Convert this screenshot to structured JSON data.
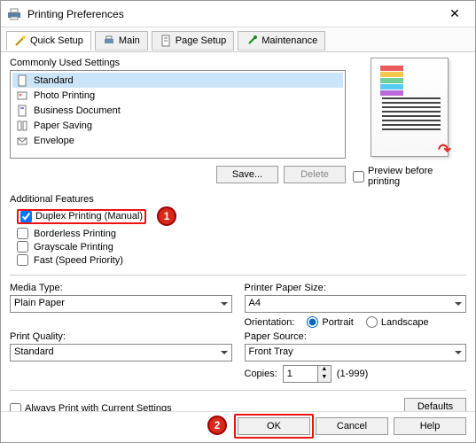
{
  "title": "Printing Preferences",
  "tabs": {
    "quick": "Quick Setup",
    "main": "Main",
    "page": "Page Setup",
    "maint": "Maintenance"
  },
  "commonly_used_label": "Commonly Used Settings",
  "settings_list": {
    "0": "Standard",
    "1": "Photo Printing",
    "2": "Business Document",
    "3": "Paper Saving",
    "4": "Envelope"
  },
  "save_btn": "Save...",
  "delete_btn": "Delete",
  "preview_checkbox": "Preview before printing",
  "additional_features_label": "Additional Features",
  "features": {
    "duplex": "Duplex Printing (Manual)",
    "borderless": "Borderless Printing",
    "grayscale": "Grayscale Printing",
    "fast": "Fast (Speed Priority)"
  },
  "annotations": {
    "a1": "1",
    "a2": "2"
  },
  "media_type_label": "Media Type:",
  "media_type_value": "Plain Paper",
  "printer_paper_label": "Printer Paper Size:",
  "printer_paper_value": "A4",
  "orientation_label": "Orientation:",
  "orientation_portrait": "Portrait",
  "orientation_landscape": "Landscape",
  "print_quality_label": "Print Quality:",
  "print_quality_value": "Standard",
  "paper_source_label": "Paper Source:",
  "paper_source_value": "Front Tray",
  "copies_label": "Copies:",
  "copies_value": "1",
  "copies_range": "(1-999)",
  "always_print_label": "Always Print with Current Settings",
  "defaults_btn": "Defaults",
  "ok_btn": "OK",
  "cancel_btn": "Cancel",
  "help_btn": "Help"
}
